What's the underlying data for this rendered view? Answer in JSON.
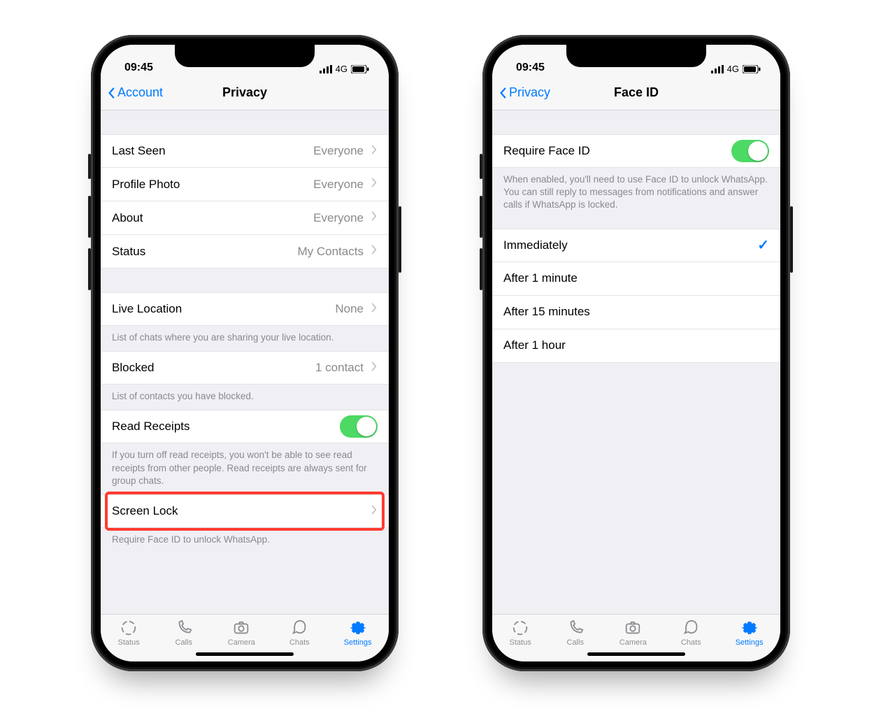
{
  "status": {
    "time": "09:45",
    "network": "4G"
  },
  "phone1": {
    "back": "Account",
    "title": "Privacy",
    "rows": {
      "lastSeen": {
        "label": "Last Seen",
        "value": "Everyone"
      },
      "photo": {
        "label": "Profile Photo",
        "value": "Everyone"
      },
      "about": {
        "label": "About",
        "value": "Everyone"
      },
      "status": {
        "label": "Status",
        "value": "My Contacts"
      },
      "liveLoc": {
        "label": "Live Location",
        "value": "None"
      },
      "liveLocNote": "List of chats where you are sharing your live location.",
      "blocked": {
        "label": "Blocked",
        "value": "1 contact"
      },
      "blockedNote": "List of contacts you have blocked.",
      "readRec": {
        "label": "Read Receipts"
      },
      "readRecNote": "If you turn off read receipts, you won't be able to see read receipts from other people. Read receipts are always sent for group chats.",
      "screenLock": {
        "label": "Screen Lock"
      },
      "screenLockNote": "Require Face ID to unlock WhatsApp."
    }
  },
  "phone2": {
    "back": "Privacy",
    "title": "Face ID",
    "toggleLabel": "Require Face ID",
    "note": "When enabled, you'll need to use Face ID to unlock WhatsApp. You can still reply to messages from notifications and answer calls if WhatsApp is locked.",
    "options": [
      "Immediately",
      "After 1 minute",
      "After 15 minutes",
      "After 1 hour"
    ],
    "selectedIndex": 0
  },
  "tabs": {
    "status": "Status",
    "calls": "Calls",
    "camera": "Camera",
    "chats": "Chats",
    "settings": "Settings"
  }
}
